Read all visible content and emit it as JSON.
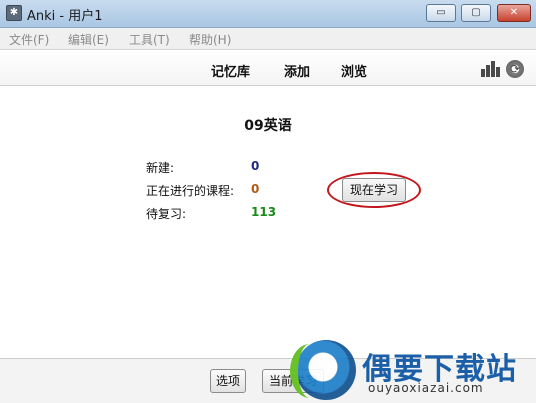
{
  "window": {
    "title": "Anki - 用户1",
    "icon_name": "anki-star-icon",
    "controls": {
      "minimize": "▭",
      "maximize": "▢",
      "close": "✕"
    }
  },
  "menubar": {
    "items": [
      "文件(F)",
      "编辑(E)",
      "工具(T)",
      "帮助(H)"
    ]
  },
  "toolbar": {
    "links": [
      "记忆库",
      "添加",
      "浏览"
    ],
    "icons": [
      "stats-icon",
      "sync-icon"
    ]
  },
  "deck": {
    "title": "09英语",
    "stats": [
      {
        "label": "新建:",
        "value": "0",
        "color": "#1c2a80"
      },
      {
        "label": "正在进行的课程:",
        "value": "0",
        "color": "#b05a17"
      },
      {
        "label": "待复习:",
        "value": "113",
        "color": "#1a8a1a"
      }
    ],
    "study_button": "现在学习",
    "highlight_color": "#c3161c"
  },
  "bottom": {
    "buttons": [
      "选项",
      "当前学习"
    ]
  },
  "watermark": {
    "title": "偶要下载站",
    "url": "ouyaoxiazai.com"
  }
}
